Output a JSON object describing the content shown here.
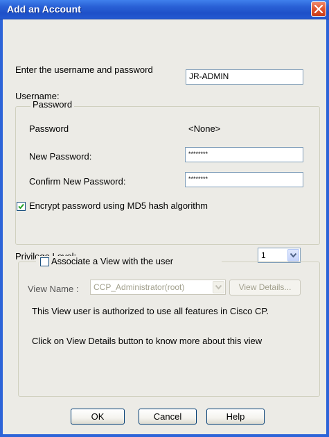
{
  "window": {
    "title": "Add an Account"
  },
  "intro_text": "Enter the username and password",
  "username": {
    "label": "Username:",
    "value": "JR-ADMIN"
  },
  "password_group": {
    "legend": "Password",
    "password_label": "Password",
    "password_value": "<None>",
    "new_password_label": "New Password:",
    "new_password_value": "********",
    "confirm_password_label": "Confirm New Password:",
    "confirm_password_value": "********",
    "encrypt_label": "Encrypt password using MD5 hash algorithm",
    "encrypt_checked": true
  },
  "privilege": {
    "label": "Privilege Level:",
    "value": "1"
  },
  "view_group": {
    "associate_label": "Associate a View with the user",
    "associate_checked": false,
    "view_name_label": "View Name :",
    "view_name_value": "CCP_Administrator(root)",
    "view_details_label": "View Details...",
    "authorized_text": "This View user is authorized to use all features in Cisco CP.",
    "info_text": "Click on View Details button to know more about this view"
  },
  "buttons": {
    "ok": "OK",
    "cancel": "Cancel",
    "help": "Help"
  },
  "colors": {
    "titlebar": "#2a61d6",
    "dialog_bg": "#ecebe6",
    "close_button": "#e05530",
    "group_border": "#d0d0bf",
    "disabled_text": "#a2a08d"
  },
  "icons": {
    "close": "close-x-icon",
    "dropdown": "chevron-down-icon",
    "checkmark": "checkmark-icon"
  }
}
